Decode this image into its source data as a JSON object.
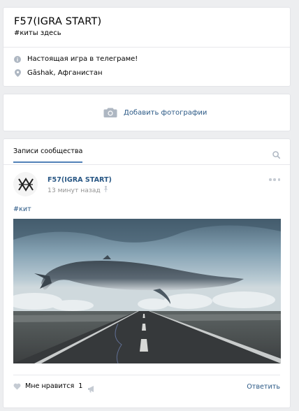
{
  "group": {
    "name": "F57(IGRA START)",
    "status": "#киты здесь",
    "description": "Настоящая игра в телеграме!",
    "location": "Gāshak, Афганистан"
  },
  "photos": {
    "add_label": "Добавить фотографии"
  },
  "wall": {
    "tab_label": "Записи сообщества",
    "post": {
      "author": "F57(IGRA START)",
      "time": "13 минут назад",
      "hashtag": "#кит",
      "likes_label": "Мне нравится",
      "likes_count": "1",
      "reply_label": "Ответить"
    }
  },
  "colors": {
    "link": "#2a5885",
    "accent": "#5181b8",
    "muted": "#939393",
    "icon": "#c5cbd3"
  },
  "icons": [
    "info-icon",
    "location-pin-icon",
    "camera-icon",
    "search-icon",
    "pin-icon",
    "more-icon",
    "heart-icon",
    "megaphone-icon"
  ]
}
